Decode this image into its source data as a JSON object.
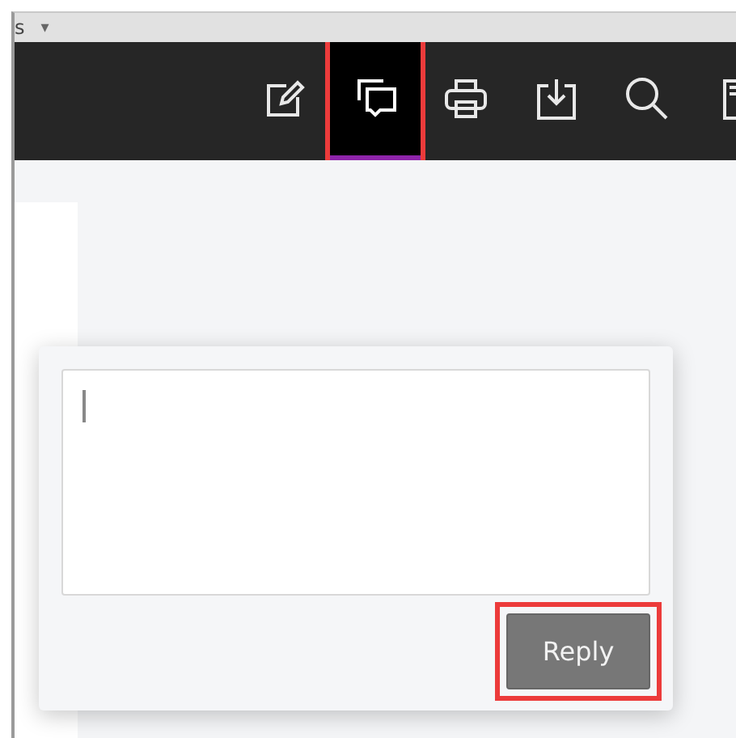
{
  "tab_strip": {
    "text": "s",
    "caret": "▾"
  },
  "toolbar": {
    "buttons": [
      {
        "kind": "edit",
        "selected": false,
        "highlighted": false
      },
      {
        "kind": "comments",
        "selected": true,
        "highlighted": true
      },
      {
        "kind": "print",
        "selected": false,
        "highlighted": false
      },
      {
        "kind": "download",
        "selected": false,
        "highlighted": false
      },
      {
        "kind": "search",
        "selected": false,
        "highlighted": false
      },
      {
        "kind": "pages",
        "selected": false,
        "highlighted": false
      }
    ]
  },
  "reply_popup": {
    "focused": true,
    "button": {
      "label": "Reply",
      "highlighted": true
    }
  }
}
